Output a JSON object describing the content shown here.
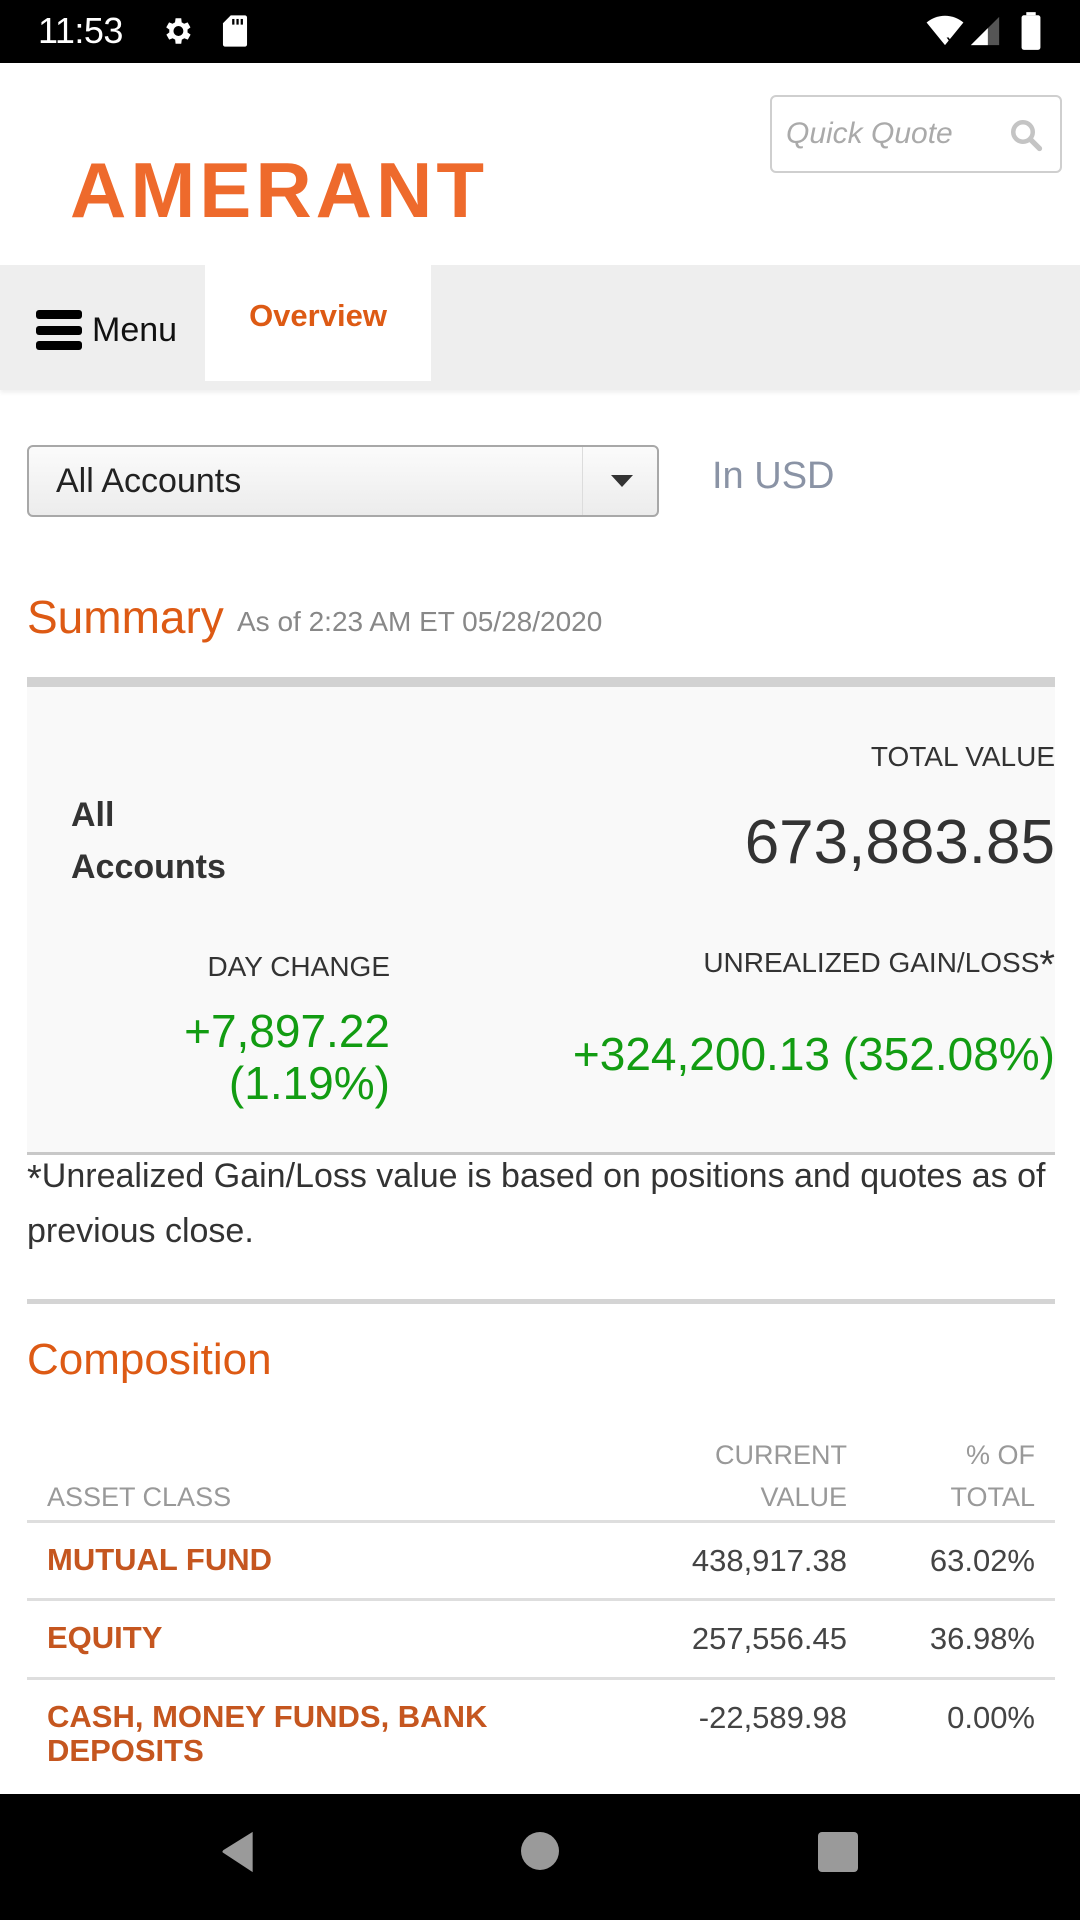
{
  "status_bar": {
    "time": "11:53",
    "left_icons": [
      "gear-icon",
      "sd-card-icon"
    ],
    "right_icons": [
      "wifi-off-icon",
      "signal-icon",
      "battery-icon"
    ]
  },
  "header": {
    "logo_text": "AMERANT",
    "brand_color": "#ee6a2c",
    "quick_quote": {
      "placeholder": "Quick Quote",
      "value": "",
      "icon": "search-icon"
    }
  },
  "nav": {
    "menu_label": "Menu",
    "menu_icon": "hamburger-icon",
    "tabs": [
      {
        "label": "Overview",
        "active": true
      }
    ]
  },
  "accounts": {
    "selected": "All Accounts",
    "currency_note": "In USD"
  },
  "summary": {
    "title": "Summary",
    "as_of": "As of 2:23 AM ET 05/28/2020",
    "account_name": "All Accounts",
    "total_value_label": "TOTAL VALUE",
    "total_value": "673,883.85",
    "day_change_label": "DAY CHANGE",
    "day_change_value": "+7,897.22",
    "day_change_pct": "(1.19%)",
    "unrealized_label": "UNREALIZED GAIN/LOSS",
    "unrealized_marker": "*",
    "unrealized_value": "+324,200.13 (352.08%)",
    "positive_color": "#129c12",
    "footnote_marker": "*",
    "footnote": "Unrealized Gain/Loss value is based on positions and quotes as of previous close."
  },
  "composition": {
    "title": "Composition",
    "columns": {
      "asset_class": "ASSET CLASS",
      "current_value_line1": "CURRENT",
      "current_value_line2": "VALUE",
      "pct_total_line1": "% OF",
      "pct_total_line2": "TOTAL"
    },
    "rows": [
      {
        "asset_class": "MUTUAL FUND",
        "current_value": "438,917.38",
        "pct_of_total": "63.02%"
      },
      {
        "asset_class": "EQUITY",
        "current_value": "257,556.45",
        "pct_of_total": "36.98%"
      },
      {
        "asset_class": "CASH, MONEY FUNDS, BANK DEPOSITS",
        "current_value": "-22,589.98",
        "pct_of_total": "0.00%"
      }
    ]
  },
  "system_nav": {
    "buttons": [
      "back-icon",
      "home-icon",
      "recents-icon"
    ]
  }
}
